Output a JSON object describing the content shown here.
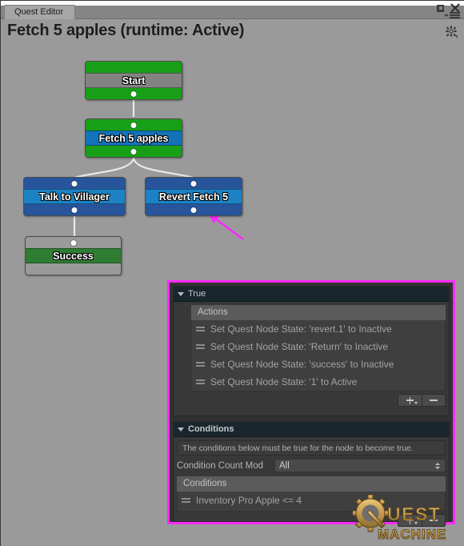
{
  "window": {
    "tab_label": "Quest Editor",
    "title": "Fetch 5 apples (runtime: Active)",
    "controls": {
      "maximize": "maximize-icon",
      "close": "close-icon",
      "menu": "hamburger-menu-icon",
      "settings": "gear-icon"
    }
  },
  "graph": {
    "nodes": [
      {
        "id": "start",
        "label": "Start",
        "style": "green-gray"
      },
      {
        "id": "fetch",
        "label": "Fetch 5 apples",
        "style": "green-blue"
      },
      {
        "id": "talk",
        "label": "Talk to Villager",
        "style": "blue"
      },
      {
        "id": "revert",
        "label": "Revert Fetch 5",
        "style": "blue"
      },
      {
        "id": "success",
        "label": "Success",
        "style": "gray-green"
      }
    ]
  },
  "inspector": {
    "true_section": {
      "header": "True",
      "list_header": "Actions",
      "items": [
        "Set Quest Node State: 'revert.1' to Inactive",
        "Set Quest Node State: 'Return' to Inactive",
        "Set Quest Node State: 'success' to Inactive",
        "Set Quest Node State: '1' to Active"
      ],
      "add_label": "+",
      "remove_label": "-"
    },
    "conditions_section": {
      "header": "Conditions",
      "help_text": "The conditions below must be true for the node to become true.",
      "count_mode_label": "Condition Count Mod",
      "count_mode_value": "All",
      "list_header": "Conditions",
      "items": [
        "Inventory Pro Apple <= 4"
      ],
      "add_label": "+",
      "remove_label": "-"
    },
    "highlight_color": "#ff29ff"
  },
  "logo": {
    "line1": "Quest",
    "line2": "Machine"
  }
}
